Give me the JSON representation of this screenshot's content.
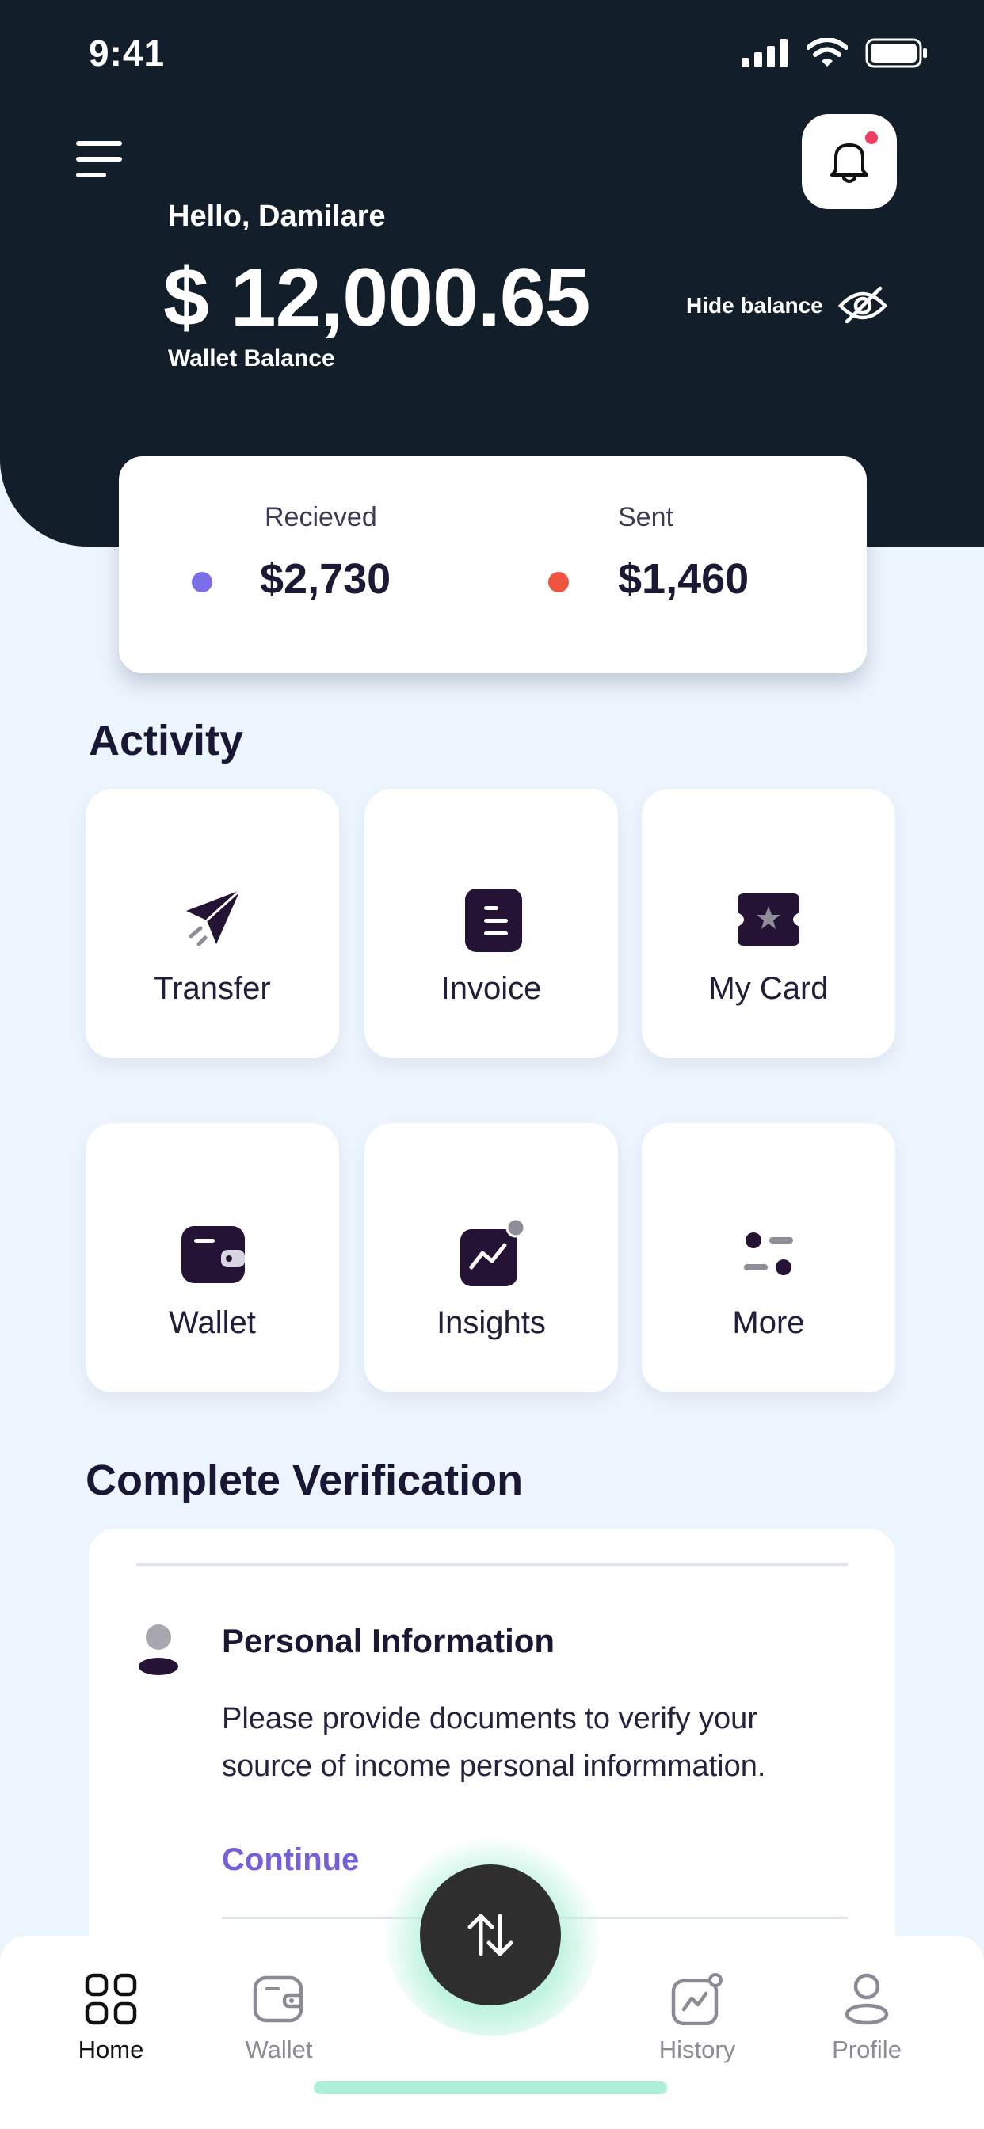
{
  "status_bar": {
    "time": "9:41"
  },
  "header": {
    "greeting": "Hello, Damilare",
    "balance": "$ 12,000.65",
    "balance_label": "Wallet Balance",
    "hide_balance_label": "Hide balance"
  },
  "summary": {
    "received_label": "Recieved",
    "received_value": "$2,730",
    "received_color": "#7b6ee6",
    "sent_label": "Sent",
    "sent_value": "$1,460",
    "sent_color": "#f0533f"
  },
  "activity": {
    "title": "Activity",
    "tiles": [
      {
        "label": "Transfer",
        "icon": "paper-plane-icon"
      },
      {
        "label": "Invoice",
        "icon": "document-icon"
      },
      {
        "label": "My Card",
        "icon": "card-ticket-icon"
      },
      {
        "label": "Wallet",
        "icon": "wallet-icon"
      },
      {
        "label": "Insights",
        "icon": "chart-icon"
      },
      {
        "label": "More",
        "icon": "more-dots-icon"
      }
    ]
  },
  "verification": {
    "title": "Complete Verification",
    "item_title": "Personal Information",
    "item_description": "Please provide documents to verify your source of income personal informmation.",
    "item_action": "Continue"
  },
  "bottom_nav": {
    "items": [
      {
        "label": "Home",
        "icon": "home-grid-icon",
        "active": true
      },
      {
        "label": "Wallet",
        "icon": "wallet-icon",
        "active": false
      },
      {
        "label": "History",
        "icon": "history-chart-icon",
        "active": false
      },
      {
        "label": "Profile",
        "icon": "profile-icon",
        "active": false
      }
    ],
    "fab_icon": "transfer-arrows-icon"
  },
  "colors": {
    "header_bg": "#131e2b",
    "page_bg": "#ecf4fd",
    "accent": "#7460d8",
    "icon_dark": "#241335"
  }
}
